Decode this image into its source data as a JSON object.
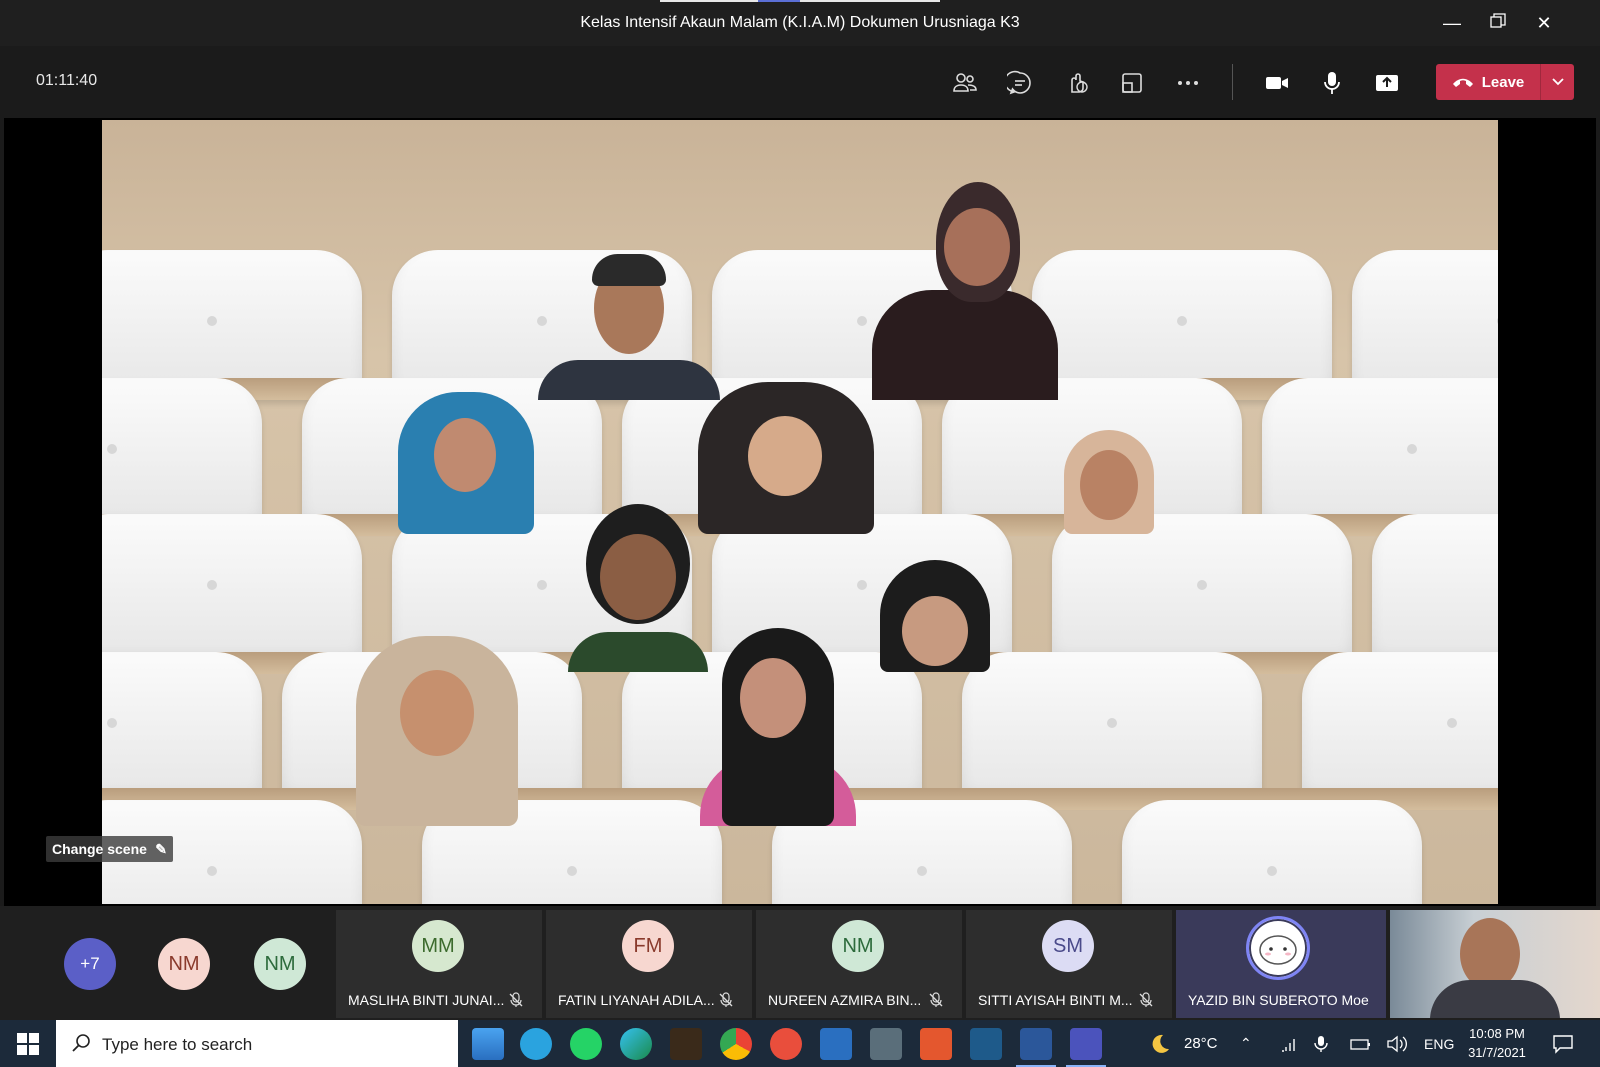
{
  "window": {
    "title": "Kelas Intensif Akaun Malam (K.I.A.M) Dokumen Urusniaga K3",
    "minimize_icon": "minimize-icon",
    "restore_icon": "restore-icon",
    "close_icon": "close-icon"
  },
  "meeting": {
    "timer": "01:11:40",
    "toolbar_icons": [
      "participants-icon",
      "chat-icon",
      "reactions-icon",
      "rooms-icon",
      "more-icon",
      "camera-icon",
      "mic-icon",
      "share-icon"
    ],
    "leave_label": "Leave",
    "leave_color": "#c4314b"
  },
  "stage": {
    "change_scene_label": "Change scene",
    "scene": "auditorium-seats"
  },
  "participants": {
    "overflow_count": "+7",
    "avatars_only": [
      {
        "initials": "NM",
        "bg": "#f7d7d0",
        "fg": "#8a3a2c"
      },
      {
        "initials": "NM",
        "bg": "#cfe8d6",
        "fg": "#2d6b3c"
      }
    ],
    "tiles": [
      {
        "initials": "MM",
        "name": "MASLIHA BINTI JUNAI...",
        "bg": "#d6e8cf",
        "fg": "#3c6b2d",
        "muted": true
      },
      {
        "initials": "FM",
        "name": "FATIN LIYANAH ADILA...",
        "bg": "#f7d7d0",
        "fg": "#8a3a2c",
        "muted": true
      },
      {
        "initials": "NM",
        "name": "NUREEN AZMIRA BIN...",
        "bg": "#cfe8d6",
        "fg": "#2d6b3c",
        "muted": true
      },
      {
        "initials": "SM",
        "name": "SITTI AYISAH BINTI M...",
        "bg": "#dcdcf4",
        "fg": "#4a4a8a",
        "muted": true
      },
      {
        "initials": "",
        "name": "YAZID BIN SUBEROTO Moe",
        "bg": "#ffffff",
        "fg": "#333",
        "muted": false,
        "speaking": true
      }
    ]
  },
  "taskbar": {
    "search_placeholder": "Type here to search",
    "weather": "28°C",
    "language": "ENG",
    "time": "10:08 PM",
    "date": "31/7/2021"
  }
}
